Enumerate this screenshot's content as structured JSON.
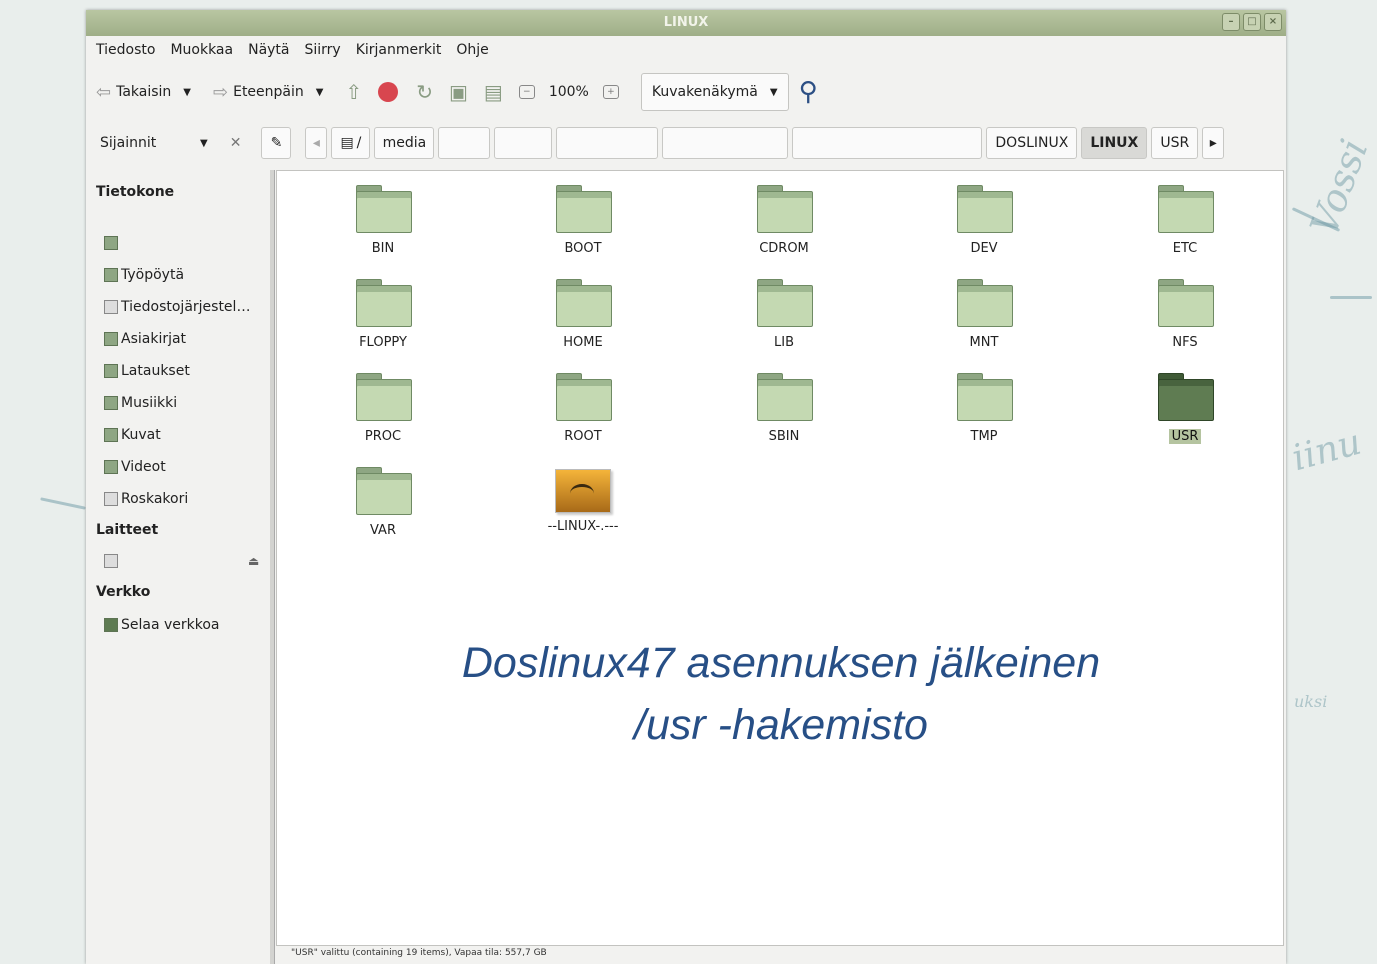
{
  "window": {
    "title": "LINUX",
    "controls": [
      "–",
      "□",
      "×"
    ]
  },
  "menu": [
    "Tiedosto",
    "Muokkaa",
    "Näytä",
    "Siirry",
    "Kirjanmerkit",
    "Ohje"
  ],
  "toolbar": {
    "back": "Takaisin",
    "forward": "Eteenpäin",
    "zoom": "100%",
    "view_mode": "Kuvakenäkymä"
  },
  "location": {
    "panel_label": "Sijainnit",
    "crumbs": [
      "/",
      "media",
      "",
      "",
      "",
      "",
      "",
      "DOSLINUX",
      "LINUX",
      "USR"
    ]
  },
  "sidebar": {
    "computer_heading": "Tietokone",
    "computer_items": [
      "Työpöytä",
      "Tiedostojärjestel…",
      "Asiakirjat",
      "Lataukset",
      "Musiikki",
      "Kuvat",
      "Videot",
      "Roskakori"
    ],
    "devices_heading": "Laitteet",
    "network_heading": "Verkko",
    "network_items": [
      "Selaa verkkoa"
    ]
  },
  "files": [
    "BIN",
    "BOOT",
    "CDROM",
    "DEV",
    "ETC",
    "FLOPPY",
    "HOME",
    "LIB",
    "MNT",
    "NFS",
    "PROC",
    "ROOT",
    "SBIN",
    "TMP",
    "USR",
    "VAR",
    "--LINUX-.---"
  ],
  "selected_file": "USR",
  "caption": {
    "line1": "Doslinux47 asennuksen jälkeinen",
    "line2": "/usr -hakemisto"
  },
  "status": "\"USR\" valittu (containing 19 items), Vapaa tila: 557,7 GB",
  "wallpaper": {
    "text1": "Vossi",
    "text2": "iinu",
    "text3": "uksi"
  }
}
